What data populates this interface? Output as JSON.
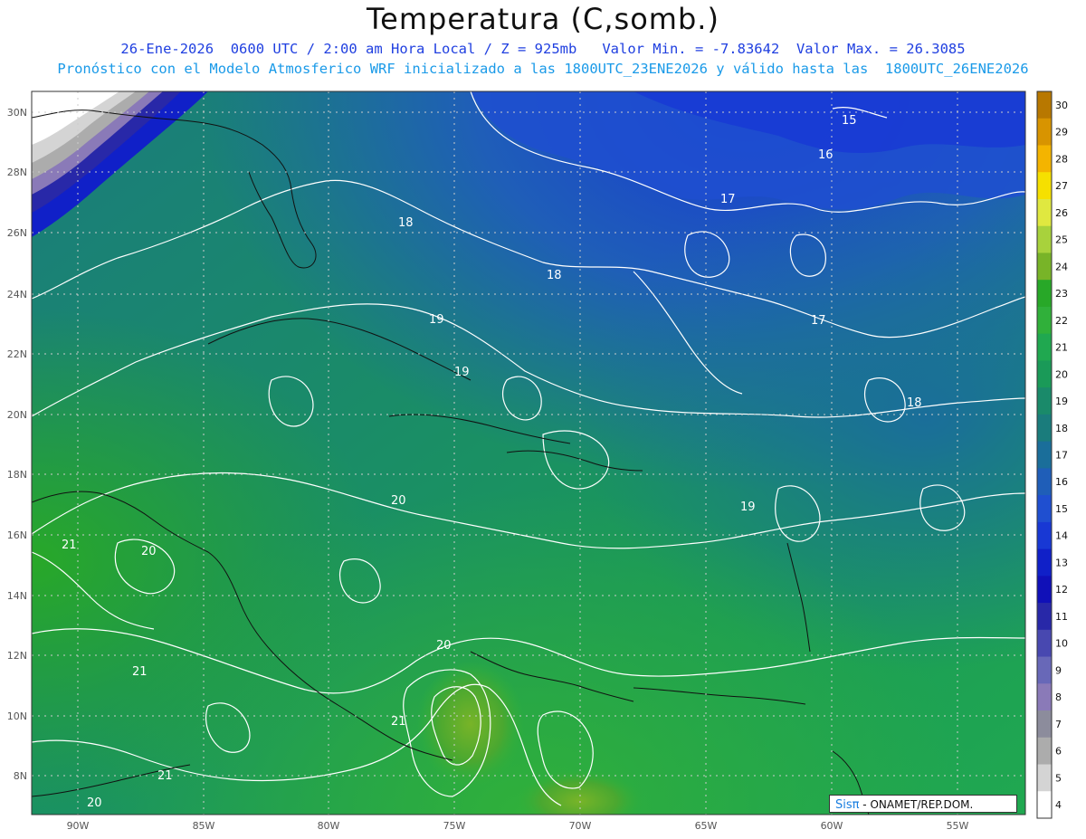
{
  "header": {
    "title": "Temperatura (C,somb.)",
    "line1": "26-Ene-2026  0600 UTC / 2:00 am Hora Local / Z = 925mb   Valor Min. = -7.83642  Valor Max. = 26.3085",
    "line2": "Pronóstico con el Modelo Atmosferico WRF inicializado a las 1800UTC_23ENE2026 y válido hasta las  1800UTC_26ENE2026"
  },
  "map": {
    "lat_labels": [
      "30N",
      "28N",
      "26N",
      "24N",
      "22N",
      "20N",
      "18N",
      "16N",
      "14N",
      "12N",
      "10N",
      "8N"
    ],
    "lon_labels": [
      "90W",
      "85W",
      "80W",
      "75W",
      "70W",
      "65W",
      "60W",
      "55W"
    ],
    "contour_labels": [
      {
        "text": "15"
      },
      {
        "text": "16"
      },
      {
        "text": "17"
      },
      {
        "text": "18"
      },
      {
        "text": "18"
      },
      {
        "text": "17"
      },
      {
        "text": "19"
      },
      {
        "text": "19"
      },
      {
        "text": "18"
      },
      {
        "text": "20"
      },
      {
        "text": "19"
      },
      {
        "text": "21"
      },
      {
        "text": "20"
      },
      {
        "text": "20"
      },
      {
        "text": "21"
      },
      {
        "text": "21"
      },
      {
        "text": "21"
      },
      {
        "text": "20"
      }
    ]
  },
  "colorbar": {
    "labels": [
      "30",
      "29",
      "28",
      "27",
      "26",
      "25",
      "24",
      "23",
      "22",
      "21",
      "20",
      "19",
      "18",
      "17",
      "16",
      "15",
      "14",
      "13",
      "12",
      "11",
      "10",
      "9",
      "8",
      "7",
      "6",
      "5",
      "4"
    ],
    "colors": [
      "#b87800",
      "#d89400",
      "#f4b400",
      "#f6e000",
      "#e0e840",
      "#a8d23c",
      "#78b428",
      "#28a828",
      "#30b03a",
      "#20a850",
      "#1a9a58",
      "#1a8a6a",
      "#1a7c7c",
      "#1a6e9a",
      "#1f5eb8",
      "#1f4fd0",
      "#1838d4",
      "#1020c8",
      "#1010b8",
      "#2828a8",
      "#4848b0",
      "#6868b8",
      "#8a7ab8",
      "#8c8c9c",
      "#acacac",
      "#d4d4d4",
      "#ffffff"
    ]
  },
  "logo": {
    "brand": "Sisπ",
    "text": "- ONAMET/REP.DOM."
  }
}
